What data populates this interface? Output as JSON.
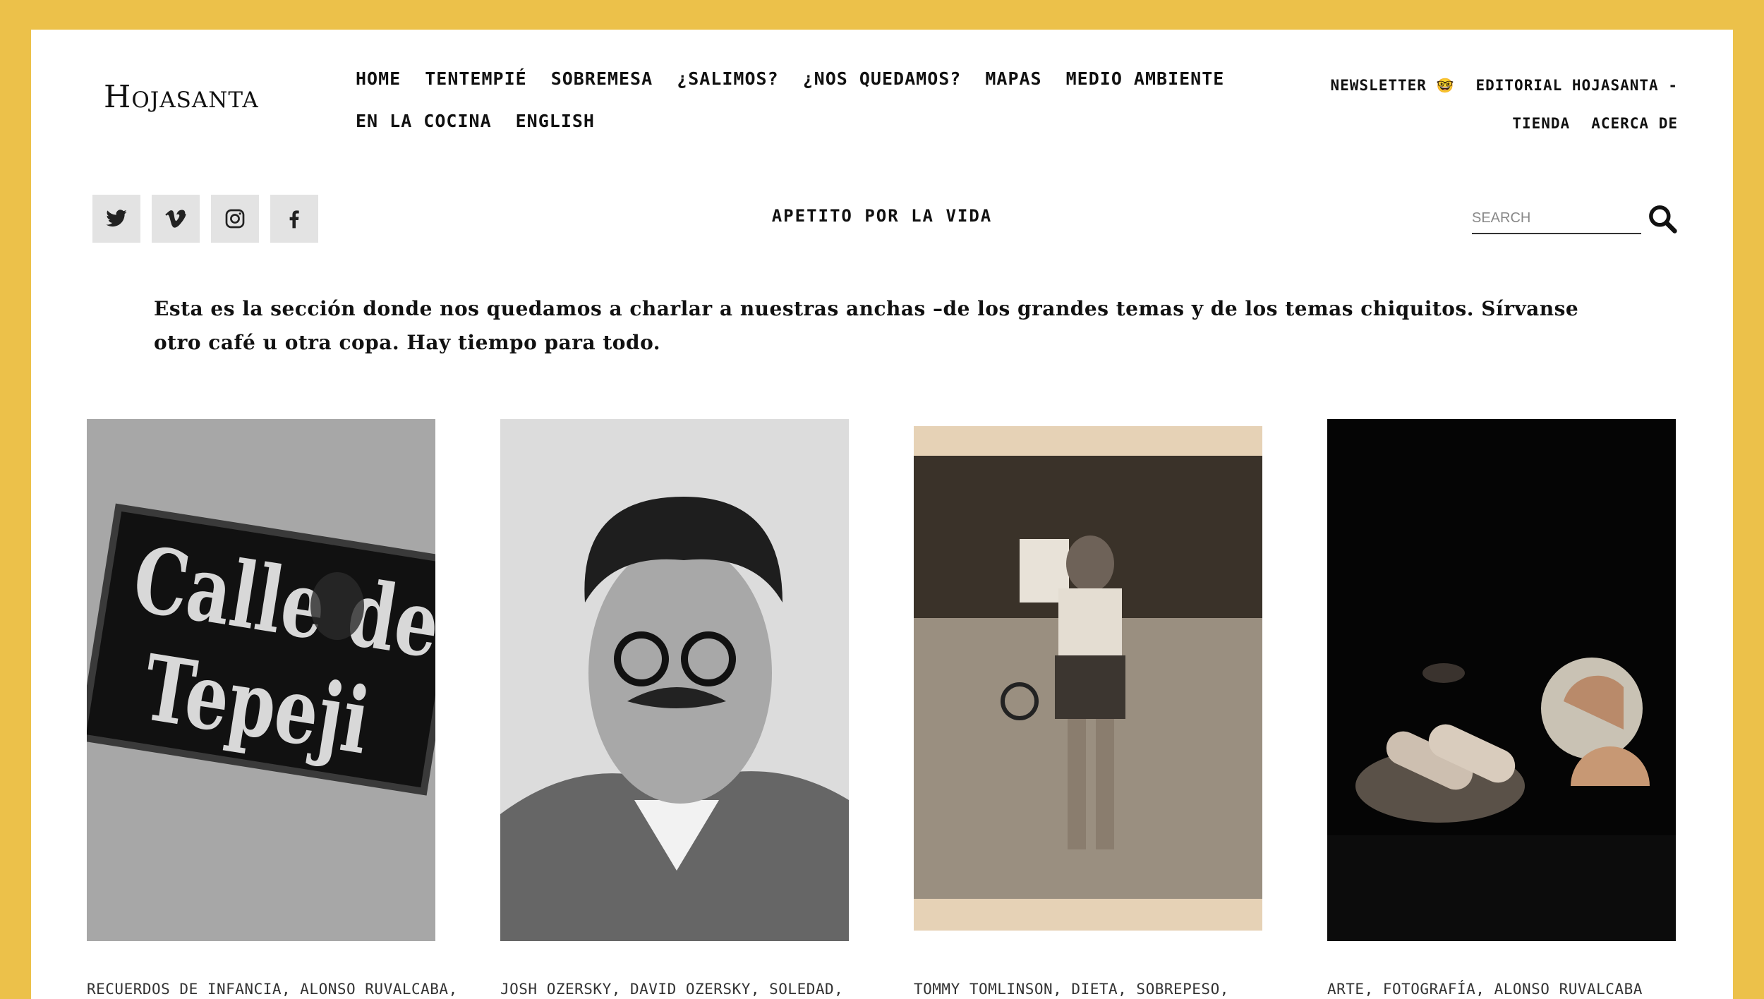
{
  "site": {
    "logo": "Hojasanta"
  },
  "nav": {
    "main": [
      "HOME",
      "TENTEMPIÉ",
      "SOBREMESA",
      "¿SALIMOS?",
      "¿NOS QUEDAMOS?",
      "MAPAS",
      "MEDIO AMBIENTE",
      "EN LA COCINA",
      "ENGLISH"
    ],
    "secondary": {
      "newsletter": "NEWSLETTER",
      "newsletter_emoji": "🤓",
      "editorial": "EDITORIAL HOJASANTA -",
      "tienda": "TIENDA",
      "acerca": "ACERCA DE"
    }
  },
  "social": [
    "twitter-icon",
    "vimeo-icon",
    "instagram-icon",
    "facebook-icon"
  ],
  "tagline": "APETITO POR LA VIDA",
  "search": {
    "placeholder": "SEARCH"
  },
  "intro": "Esta es la sección donde nos quedamos a charlar a nuestras anchas –de los grandes temas y de los temas chiquitos. Sírvanse otro café u otra copa. Hay tiempo para todo.",
  "cards": [
    {
      "tags": "RECUERDOS DE INFANCIA, ALONSO RUVALCABA,"
    },
    {
      "tags": "JOSH OZERSKY, DAVID OZERSKY, SOLEDAD,"
    },
    {
      "tags": "TOMMY TOMLINSON, DIETA, SOBREPESO,"
    },
    {
      "tags": "ARTE, FOTOGRAFÍA, ALONSO RUVALCABA"
    }
  ],
  "colors": {
    "frame": "#ecc14a",
    "social_bg": "#e3e3e3"
  }
}
